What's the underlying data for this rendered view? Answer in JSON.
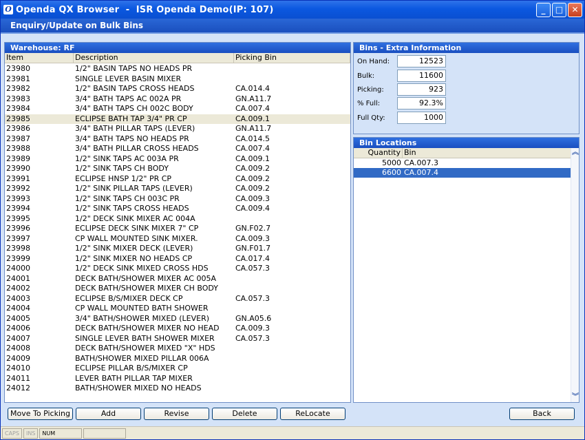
{
  "window": {
    "title": "Openda QX Browser  -  ISR Openda Demo(IP: 107)",
    "app_icon_glyph": "O"
  },
  "header": {
    "title": "Enquiry/Update on Bulk Bins"
  },
  "warehouse_panel": {
    "title": "Warehouse: RF",
    "columns": [
      "Item",
      "Description",
      "Picking Bin"
    ],
    "selected_index": 5,
    "rows": [
      {
        "item": "23980",
        "description": "1/2\" BASIN TAPS NO HEADS PR",
        "bin": ""
      },
      {
        "item": "23981",
        "description": "SINGLE LEVER BASIN MIXER",
        "bin": ""
      },
      {
        "item": "23982",
        "description": "1/2\" BASIN TAPS CROSS HEADS",
        "bin": "CA.014.4"
      },
      {
        "item": "23983",
        "description": "3/4\" BATH TAPS AC 002A PR",
        "bin": "GN.A11.7"
      },
      {
        "item": "23984",
        "description": "3/4\" BATH TAPS CH 002C BODY",
        "bin": "CA.007.4"
      },
      {
        "item": "23985",
        "description": "ECLIPSE BATH TAP 3/4\" PR CP",
        "bin": "CA.009.1"
      },
      {
        "item": "23986",
        "description": "3/4\" BATH PILLAR TAPS (LEVER)",
        "bin": "GN.A11.7"
      },
      {
        "item": "23987",
        "description": "3/4\" BATH TAPS NO HEADS PR",
        "bin": "CA.014.5"
      },
      {
        "item": "23988",
        "description": "3/4\" BATH PILLAR CROSS HEADS",
        "bin": "CA.007.4"
      },
      {
        "item": "23989",
        "description": "1/2\" SINK TAPS AC 003A PR",
        "bin": "CA.009.1"
      },
      {
        "item": "23990",
        "description": "1/2\" SINK TAPS CH BODY",
        "bin": "CA.009.2"
      },
      {
        "item": "23991",
        "description": "ECLIPSE HNSP 1/2\" PR CP",
        "bin": "CA.009.2"
      },
      {
        "item": "23992",
        "description": "1/2\" SINK PILLAR TAPS (LEVER)",
        "bin": "CA.009.2"
      },
      {
        "item": "23993",
        "description": "1/2\" SINK TAPS CH 003C PR",
        "bin": "CA.009.3"
      },
      {
        "item": "23994",
        "description": "1/2\" SINK TAPS CROSS HEADS",
        "bin": "CA.009.4"
      },
      {
        "item": "23995",
        "description": "1/2\" DECK SINK MIXER AC 004A",
        "bin": ""
      },
      {
        "item": "23996",
        "description": "ECLIPSE DECK SINK MIXER 7\" CP",
        "bin": "GN.F02.7"
      },
      {
        "item": "23997",
        "description": "CP WALL MOUNTED SINK MIXER.",
        "bin": "CA.009.3"
      },
      {
        "item": "23998",
        "description": "1/2\" SINK MIXER DECK (LEVER)",
        "bin": "GN.F01.7"
      },
      {
        "item": "23999",
        "description": "1/2\" SINK MIXER NO HEADS CP",
        "bin": "CA.017.4"
      },
      {
        "item": "24000",
        "description": "1/2\" DECK SINK MIXED CROSS HDS",
        "bin": "CA.057.3"
      },
      {
        "item": "24001",
        "description": "DECK BATH/SHOWER MIXER AC 005A",
        "bin": ""
      },
      {
        "item": "24002",
        "description": "DECK BATH/SHOWER MIXER CH BODY",
        "bin": ""
      },
      {
        "item": "24003",
        "description": "ECLIPSE B/S/MIXER DECK CP",
        "bin": "CA.057.3"
      },
      {
        "item": "24004",
        "description": "CP WALL MOUNTED BATH SHOWER",
        "bin": ""
      },
      {
        "item": "24005",
        "description": "3/4\" BATH/SHOWER MIXED (LEVER)",
        "bin": "GN.A05.6"
      },
      {
        "item": "24006",
        "description": "DECK BATH/SHOWER MIXER NO HEAD",
        "bin": "CA.009.3"
      },
      {
        "item": "24007",
        "description": "SINGLE LEVER BATH SHOWER MIXER",
        "bin": "CA.057.3"
      },
      {
        "item": "24008",
        "description": "DECK BATH/SHOWER MIXED \"X\" HDS",
        "bin": ""
      },
      {
        "item": "24009",
        "description": "BATH/SHOWER MIXED PILLAR 006A",
        "bin": ""
      },
      {
        "item": "24010",
        "description": "ECLIPSE PILLAR B/S/MIXER CP",
        "bin": ""
      },
      {
        "item": "24011",
        "description": "LEVER BATH PILLAR TAP MIXER",
        "bin": ""
      },
      {
        "item": "24012",
        "description": "BATH/SHOWER MIXED NO HEADS",
        "bin": ""
      }
    ]
  },
  "extra_info": {
    "title": "Bins - Extra Information",
    "fields": [
      {
        "label": "On Hand:",
        "value": "12523"
      },
      {
        "label": "Bulk:",
        "value": "11600"
      },
      {
        "label": "Picking:",
        "value": "923"
      },
      {
        "label": "% Full:",
        "value": "92.3%"
      },
      {
        "label": "Full Qty:",
        "value": "1000"
      }
    ]
  },
  "bin_locations": {
    "title": "Bin Locations",
    "columns": [
      "Quantity",
      "Bin"
    ],
    "selected_index": 1,
    "rows": [
      {
        "quantity": "5000",
        "bin": "CA.007.3"
      },
      {
        "quantity": "6600",
        "bin": "CA.007.4"
      }
    ]
  },
  "buttons": {
    "move_to_picking": "Move To Picking",
    "add": "Add",
    "revise": "Revise",
    "delete": "Delete",
    "relocate": "ReLocate",
    "back": "Back"
  },
  "statusbar": {
    "caps": "CAPS",
    "ins": "INS",
    "num": "NUM"
  }
}
